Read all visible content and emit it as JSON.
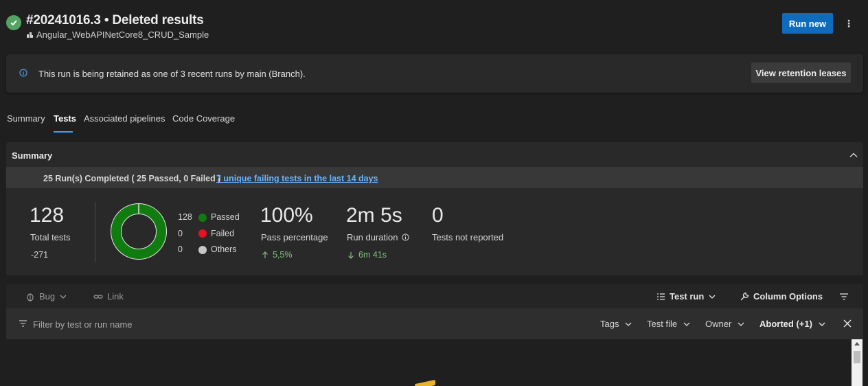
{
  "header": {
    "run_title": "#20241016.3 • Deleted results",
    "pipeline_name": "Angular_WebAPINetCore8_CRUD_Sample",
    "run_new_label": "Run new",
    "more_label": "⋮"
  },
  "banner": {
    "message": "This run is being retained as one of 3 recent runs by main (Branch).",
    "button_label": "View retention leases"
  },
  "tabs": [
    {
      "label": "Summary",
      "active": false
    },
    {
      "label": "Tests",
      "active": true
    },
    {
      "label": "Associated pipelines",
      "active": false
    },
    {
      "label": "Code Coverage",
      "active": false
    }
  ],
  "summary": {
    "header": "Summary",
    "runs_completed": "25 Run(s) Completed ( 25 Passed, 0 Failed )",
    "failing_link": "7 unique failing tests in the last 14 days",
    "total_tests": {
      "value": "128",
      "label": "Total tests",
      "delta": "-271"
    },
    "donut": {
      "passed_fraction": 1.0
    },
    "legend": [
      {
        "count": "128",
        "label": "Passed",
        "color": "#107c10"
      },
      {
        "count": "0",
        "label": "Failed",
        "color": "#e81123"
      },
      {
        "count": "0",
        "label": "Others",
        "color": "#c8c8c8"
      }
    ],
    "pass_percentage": {
      "value": "100%",
      "label": "Pass percentage",
      "delta": "5,5%"
    },
    "run_duration": {
      "value": "2m 5s",
      "label": "Run duration",
      "delta": "6m 41s"
    },
    "not_reported": {
      "value": "0",
      "label": "Tests not reported"
    }
  },
  "toolbar": {
    "bug_label": "Bug",
    "link_label": "Link",
    "test_run_label": "Test run",
    "column_options_label": "Column Options"
  },
  "filter": {
    "placeholder": "Filter by test or run name",
    "tags_label": "Tags",
    "test_file_label": "Test file",
    "owner_label": "Owner",
    "outcome_label": "Aborted (+1)"
  },
  "colors": {
    "accent": "#0f6cbd",
    "link": "#6cb2ff",
    "success": "#55a362",
    "trend_up": "#7fc27a"
  }
}
